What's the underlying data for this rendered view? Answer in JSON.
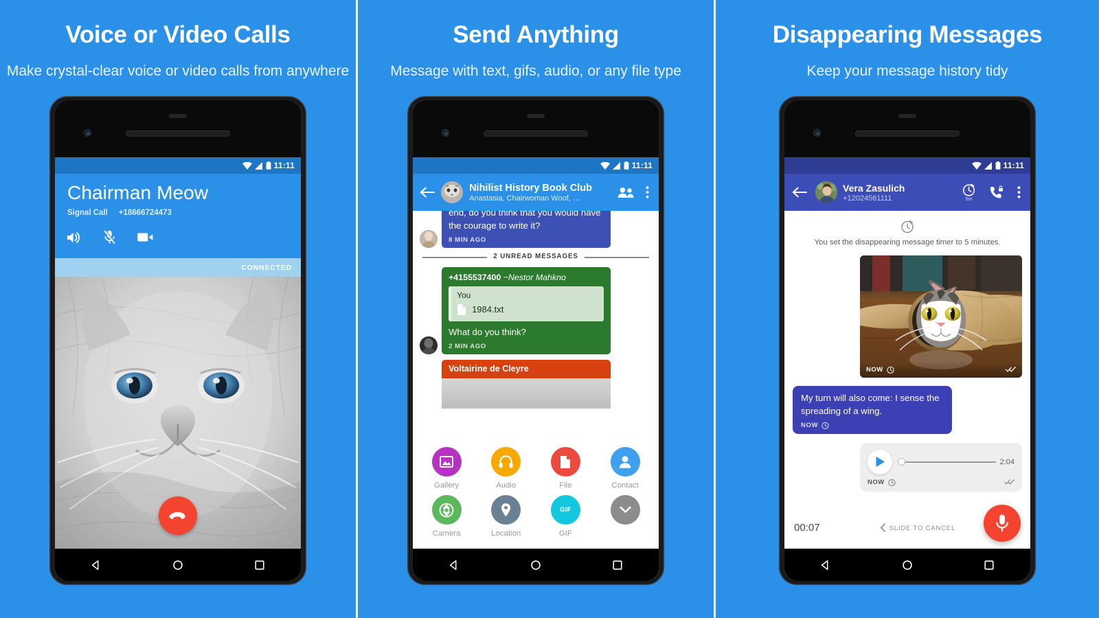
{
  "panels": [
    {
      "title": "Voice or Video Calls",
      "subtitle": "Make crystal-clear voice or video calls from anywhere",
      "status": {
        "time": "11:11",
        "icons": [
          "wifi-icon",
          "signal-icon",
          "battery-icon"
        ]
      },
      "call": {
        "contact_name": "Chairman Meow",
        "call_type": "Signal Call",
        "phone_number": "+18666724473",
        "actions": [
          "speaker-icon",
          "mic-muted-icon",
          "video-camera-icon"
        ],
        "status_label": "CONNECTED",
        "end_call_label": "end-call",
        "photo_alt": "Grey fluffy cat with blue eyes"
      },
      "nav": [
        "back-icon",
        "home-icon",
        "recents-icon"
      ]
    },
    {
      "title": "Send Anything",
      "subtitle": "Message with text, gifs, audio, or any file type",
      "status": {
        "time": "11:11",
        "icons": [
          "wifi-icon",
          "signal-icon",
          "battery-icon"
        ]
      },
      "chat": {
        "group_name": "Nihilist History Book Club",
        "members": "Anastasia, Chairwoman Woof, …",
        "appbar_icons": [
          "group-members-icon",
          "overflow-menu-icon"
        ],
        "top_message": {
          "text": "end, do you think that you would have the courage to write it?",
          "time": "8 MIN AGO"
        },
        "unread_label": "2 UNREAD MESSAGES",
        "green_message": {
          "author_number": "+4155537400",
          "author_name": "~Nestor Mahkno",
          "quote_author": "You",
          "quote_file": "1984.txt",
          "text": "What do you think?",
          "time": "2 MIN AGO"
        },
        "card_message": {
          "title": "Voltairine de Cleyre"
        },
        "attachments": [
          {
            "label": "Gallery",
            "icon": "gallery-icon",
            "color": "#b632c2"
          },
          {
            "label": "Audio",
            "icon": "headphones-icon",
            "color": "#f9a800"
          },
          {
            "label": "File",
            "icon": "file-icon",
            "color": "#ec4a3f"
          },
          {
            "label": "Contact",
            "icon": "contact-icon",
            "color": "#3fa0ee"
          },
          {
            "label": "Camera",
            "icon": "camera-icon",
            "color": "#5cb85c"
          },
          {
            "label": "Location",
            "icon": "location-pin-icon",
            "color": "#6a8194"
          },
          {
            "label": "GIF",
            "icon": "gif-icon",
            "color": "#13c7de"
          },
          {
            "label": "",
            "icon": "chevron-down-icon",
            "color": "#8c8c8c"
          }
        ]
      },
      "nav": [
        "back-icon",
        "home-icon",
        "recents-icon"
      ]
    },
    {
      "title": "Disappearing Messages",
      "subtitle": "Keep your message history tidy",
      "status": {
        "time": "11:11",
        "icons": [
          "wifi-icon",
          "signal-icon",
          "battery-icon"
        ]
      },
      "disappearing": {
        "contact_name": "Vera Zasulich",
        "phone_number": "+12024561111",
        "timer_badge": "5m",
        "appbar_icons": [
          "timer-icon",
          "secure-call-icon",
          "overflow-menu-icon"
        ],
        "timer_note": "You set the disappearing message timer to 5 minutes.",
        "image_message": {
          "time": "NOW",
          "photo_alt": "Cat peeking out of a paper bag"
        },
        "text_message": {
          "text": "My turn will also come: I sense the spreading of a wing.",
          "time": "NOW"
        },
        "audio_message": {
          "duration": "2:04",
          "time": "NOW",
          "play_label": "play-icon"
        },
        "recorder": {
          "elapsed": "00:07",
          "hint": "SLIDE TO CANCEL",
          "mic_label": "microphone-icon"
        }
      },
      "nav": [
        "back-icon",
        "home-icon",
        "recents-icon"
      ]
    }
  ],
  "theme": {
    "brand_blue": "#2b91e8",
    "indigo": "#3d4db7",
    "green": "#2c7a2e",
    "orange": "#d8400f",
    "red": "#f4432e"
  }
}
